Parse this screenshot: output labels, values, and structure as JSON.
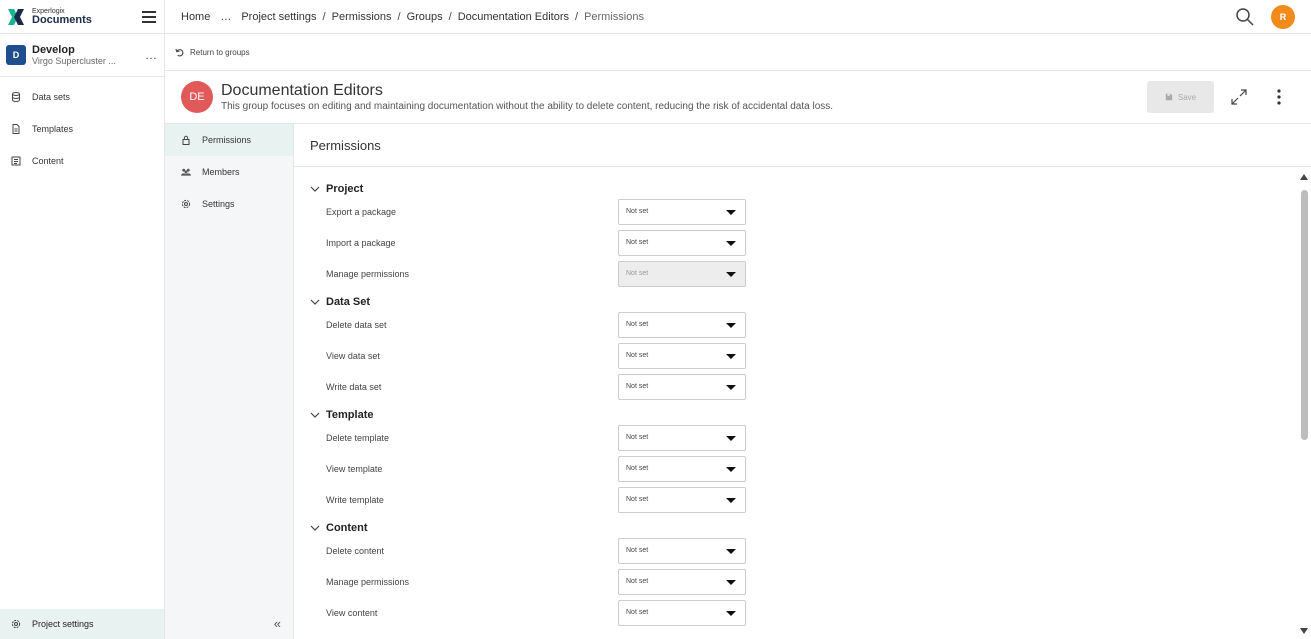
{
  "brand": {
    "line1": "Experlogix",
    "line2": "Documents"
  },
  "project": {
    "badge": "D",
    "name": "Develop",
    "subtitle": "Virgo Supercluster ...",
    "more": "…"
  },
  "sidebar": {
    "items": [
      {
        "label": "Data sets",
        "icon": "database-icon"
      },
      {
        "label": "Templates",
        "icon": "file-icon"
      },
      {
        "label": "Content",
        "icon": "content-icon"
      }
    ],
    "bottom": {
      "label": "Project settings",
      "icon": "gear-icon"
    }
  },
  "breadcrumb": {
    "home": "Home",
    "ellipsis": "…",
    "items": [
      "Project settings",
      "Permissions",
      "Groups",
      "Documentation Editors"
    ],
    "current": "Permissions",
    "separator": "/"
  },
  "user": {
    "initial": "R",
    "color": "#f28a1c"
  },
  "return_link": "Return to groups",
  "group": {
    "initials": "DE",
    "title": "Documentation Editors",
    "description": "This group focuses on editing and maintaining documentation without the ability to delete content, reducing the risk of accidental data loss.",
    "color": "#e05a5a"
  },
  "actions": {
    "save_label": "Save"
  },
  "subnav": {
    "items": [
      {
        "label": "Permissions",
        "icon": "lock-icon",
        "active": true
      },
      {
        "label": "Members",
        "icon": "users-icon",
        "active": false
      },
      {
        "label": "Settings",
        "icon": "gear-icon",
        "active": false
      }
    ],
    "collapse": "«"
  },
  "main": {
    "title": "Permissions",
    "sections": [
      {
        "title": "Project",
        "rows": [
          {
            "label": "Export a package",
            "value": "Not set",
            "disabled": false
          },
          {
            "label": "Import a package",
            "value": "Not set",
            "disabled": false
          },
          {
            "label": "Manage permissions",
            "value": "Not set",
            "disabled": true
          }
        ]
      },
      {
        "title": "Data Set",
        "rows": [
          {
            "label": "Delete data set",
            "value": "Not set",
            "disabled": false
          },
          {
            "label": "View data set",
            "value": "Not set",
            "disabled": false
          },
          {
            "label": "Write data set",
            "value": "Not set",
            "disabled": false
          }
        ]
      },
      {
        "title": "Template",
        "rows": [
          {
            "label": "Delete template",
            "value": "Not set",
            "disabled": false
          },
          {
            "label": "View template",
            "value": "Not set",
            "disabled": false
          },
          {
            "label": "Write template",
            "value": "Not set",
            "disabled": false
          }
        ]
      },
      {
        "title": "Content",
        "rows": [
          {
            "label": "Delete content",
            "value": "Not set",
            "disabled": false
          },
          {
            "label": "Manage permissions",
            "value": "Not set",
            "disabled": false
          },
          {
            "label": "View content",
            "value": "Not set",
            "disabled": false
          }
        ]
      }
    ]
  }
}
